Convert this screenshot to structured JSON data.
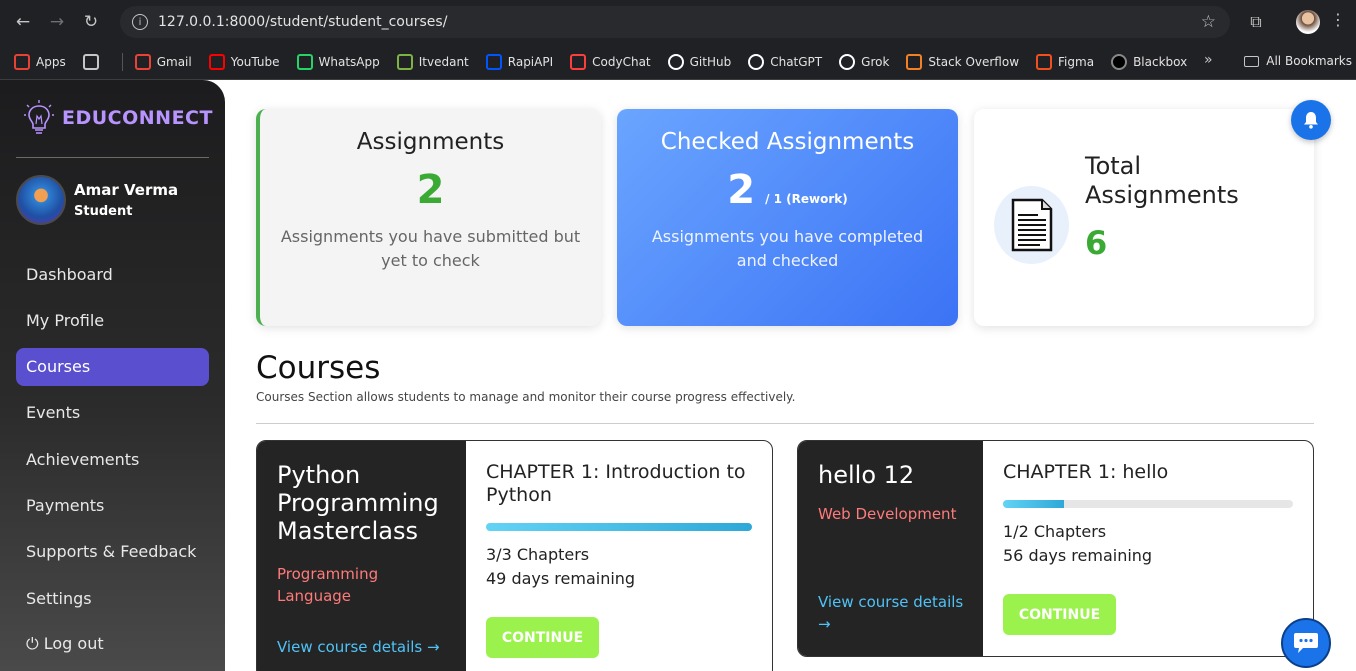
{
  "browser": {
    "url": "127.0.0.1:8000/student/student_courses/",
    "bookmarks": [
      {
        "label": "Apps",
        "icon": "apps-grid-icon",
        "color": "#e94235"
      },
      {
        "label": "",
        "icon": "tab-groups-icon",
        "color": "#c4c7c5"
      },
      {
        "label": "Gmail",
        "icon": "gmail-icon",
        "color": "#ea4335"
      },
      {
        "label": "YouTube",
        "icon": "youtube-icon",
        "color": "#ff0000"
      },
      {
        "label": "WhatsApp",
        "icon": "whatsapp-icon",
        "color": "#25d366"
      },
      {
        "label": "Itvedant",
        "icon": "itvedant-icon",
        "color": "#7cb342"
      },
      {
        "label": "RapiAPI",
        "icon": "rapidapi-icon",
        "color": "#0055ff"
      },
      {
        "label": "CodyChat",
        "icon": "codychat-icon",
        "color": "#ff3d3d"
      },
      {
        "label": "GitHub",
        "icon": "github-icon",
        "color": "#ffffff"
      },
      {
        "label": "ChatGPT",
        "icon": "chatgpt-icon",
        "color": "#ffffff"
      },
      {
        "label": "Grok",
        "icon": "grok-icon",
        "color": "#ffffff"
      },
      {
        "label": "Stack Overflow",
        "icon": "stackoverflow-icon",
        "color": "#f48024"
      },
      {
        "label": "Figma",
        "icon": "figma-icon",
        "color": "#f24e1e"
      },
      {
        "label": "Blackbox",
        "icon": "blackbox-icon",
        "color": "#000000"
      }
    ],
    "all_bookmarks": "All Bookmarks"
  },
  "sidebar": {
    "brand": "EDUCONNECT",
    "user_name": "Amar Verma",
    "user_role": "Student",
    "items": [
      {
        "label": "Dashboard",
        "active": false
      },
      {
        "label": "My Profile",
        "active": false
      },
      {
        "label": "Courses",
        "active": true
      },
      {
        "label": "Events",
        "active": false
      },
      {
        "label": "Achievements",
        "active": false
      },
      {
        "label": "Payments",
        "active": false
      },
      {
        "label": "Supports & Feedback",
        "active": false
      },
      {
        "label": "Settings",
        "active": false
      },
      {
        "label": "⏻ Log out",
        "active": false
      }
    ]
  },
  "stats": {
    "assignments": {
      "title": "Assignments",
      "value": "2",
      "desc": "Assignments you have submitted but yet to check"
    },
    "checked": {
      "title": "Checked Assignments",
      "value": "2",
      "rework": "/ 1 (Rework)",
      "desc": "Assignments you have completed and checked"
    },
    "total": {
      "title": "Total Assignments",
      "value": "6"
    }
  },
  "courses_section": {
    "title": "Courses",
    "subtitle": "Courses Section allows students to manage and monitor their course progress effectively."
  },
  "courses": [
    {
      "title": "Python Programming Masterclass",
      "category": "Programming Language",
      "view_label": "View course details →",
      "chapter": "CHAPTER 1: Introduction to Python",
      "progress": 1.0,
      "chapters_text": "3/3 Chapters",
      "remaining_text": "49 days remaining",
      "button": "CONTINUE"
    },
    {
      "title": "hello 12",
      "category": "Web Development",
      "view_label": "View course details →",
      "chapter": "CHAPTER 1: hello",
      "progress": 0.21,
      "chapters_text": "1/2 Chapters",
      "remaining_text": "56 days remaining",
      "button": "CONTINUE"
    }
  ],
  "colors": {
    "accent": "#5a4fcf",
    "green": "#3aaa35",
    "blue": "#1a73e8",
    "button": "#9cf24c"
  }
}
